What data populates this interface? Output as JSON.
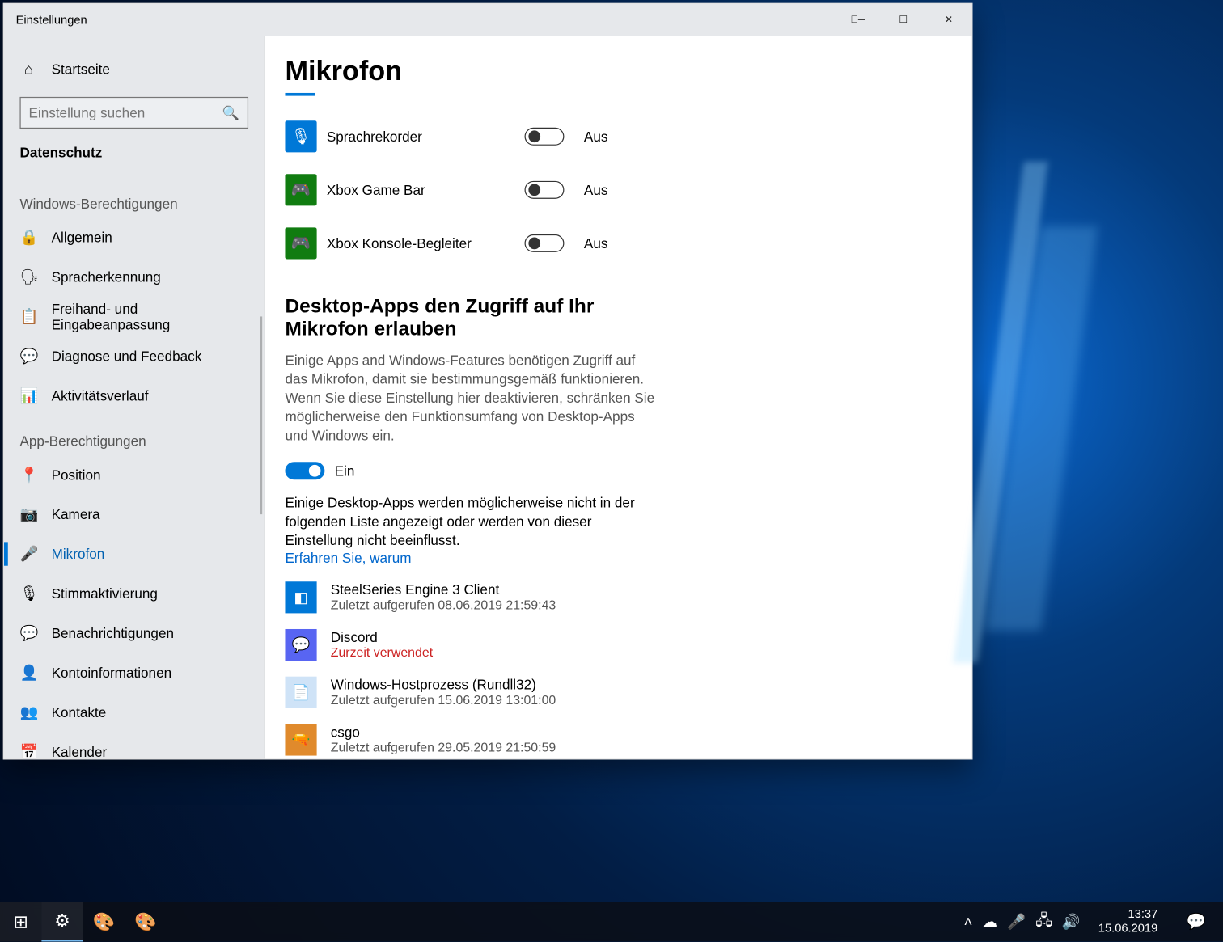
{
  "window": {
    "title": "Einstellungen",
    "home": "Startseite",
    "search_placeholder": "Einstellung suchen",
    "current_category": "Datenschutz"
  },
  "sidebar": {
    "section_windows": "Windows-Berechtigungen",
    "section_apps": "App-Berechtigungen",
    "items_win": [
      {
        "icon": "🔒",
        "label": "Allgemein"
      },
      {
        "icon": "🗣",
        "label": "Spracherkennung"
      },
      {
        "icon": "📋",
        "label": "Freihand- und Eingabeanpassung"
      },
      {
        "icon": "💬",
        "label": "Diagnose und Feedback"
      },
      {
        "icon": "📊",
        "label": "Aktivitätsverlauf"
      }
    ],
    "items_app": [
      {
        "icon": "📍",
        "label": "Position"
      },
      {
        "icon": "📷",
        "label": "Kamera"
      },
      {
        "icon": "🎤",
        "label": "Mikrofon"
      },
      {
        "icon": "🎙",
        "label": "Stimmaktivierung"
      },
      {
        "icon": "💬",
        "label": "Benachrichtigungen"
      },
      {
        "icon": "👤",
        "label": "Kontoinformationen"
      },
      {
        "icon": "👥",
        "label": "Kontakte"
      },
      {
        "icon": "📅",
        "label": "Kalender"
      }
    ]
  },
  "content": {
    "heading": "Mikrofon",
    "apps": [
      {
        "name": "Sprachrekorder",
        "state": "Aus",
        "color": "#0078d7",
        "icon": "🎙"
      },
      {
        "name": "Xbox Game Bar",
        "state": "Aus",
        "color": "#107c10",
        "icon": "🎮"
      },
      {
        "name": "Xbox Konsole-Begleiter",
        "state": "Aus",
        "color": "#107c10",
        "icon": "🎮"
      }
    ],
    "desktop_section_title": "Desktop-Apps den Zugriff auf Ihr Mikrofon erlauben",
    "desktop_section_desc": "Einige Apps and Windows-Features benötigen Zugriff auf das Mikrofon, damit sie bestimmungsgemäß funktionieren. Wenn Sie diese Einstellung hier deaktivieren, schränken Sie möglicherweise den Funktionsumfang von Desktop-Apps und Windows ein.",
    "desktop_toggle_state": "Ein",
    "desktop_note": "Einige Desktop-Apps werden möglicherweise nicht in der folgenden Liste angezeigt oder werden von dieser Einstellung nicht beeinflusst.",
    "desktop_link": "Erfahren Sie, warum",
    "desktop_apps": [
      {
        "name": "SteelSeries Engine 3 Client",
        "sub": "Zuletzt aufgerufen 08.06.2019 21:59:43",
        "color": "#0078d7",
        "red": false,
        "icon": "◧"
      },
      {
        "name": "Discord",
        "sub": "Zurzeit verwendet",
        "color": "#5865f2",
        "red": true,
        "icon": "💬"
      },
      {
        "name": "Windows-Hostprozess (Rundll32)",
        "sub": "Zuletzt aufgerufen 15.06.2019 13:01:00",
        "color": "#cfe3f7",
        "red": false,
        "icon": "📄"
      },
      {
        "name": "csgo",
        "sub": "Zuletzt aufgerufen 29.05.2019 21:50:59",
        "color": "#e08a2c",
        "red": false,
        "icon": "🔫"
      }
    ]
  },
  "taskbar": {
    "time": "13:37",
    "date": "15.06.2019"
  }
}
